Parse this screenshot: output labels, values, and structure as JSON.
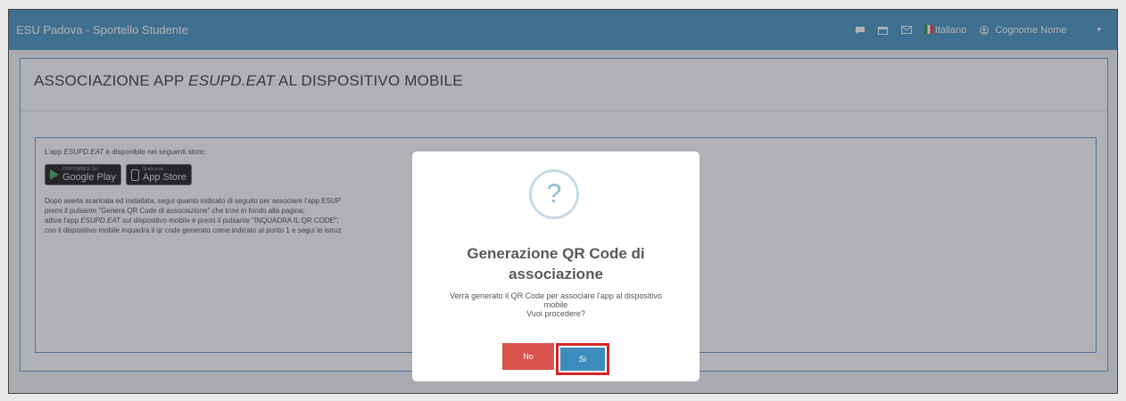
{
  "navbar": {
    "brand": "ESU Padova - Sportello Studente",
    "language": "Italiano",
    "user": "Cognome Nome"
  },
  "page": {
    "title_prefix": "ASSOCIAZIONE APP ",
    "title_app": "ESUPD.EAT",
    "title_suffix": " AL DISPOSITIVO MOBILE"
  },
  "body": {
    "intro_prefix": "L'app ",
    "intro_app": "ESUPD.EAT",
    "intro_suffix": " è disponibile nei seguenti store:",
    "google_play_small": "DISPONIBILE SU",
    "google_play": "Google Play",
    "app_store_small": "Scarica su",
    "app_store": "App Store",
    "step0": "Dopo averla scaricata ed installata, segui quanto indicato di seguito per associare l'app ESUP",
    "step1": "premi il pulsante \"Genera QR Code di associazione\" che trovi in fondo alla pagina;",
    "step2_prefix": "attiva l'app ",
    "step2_app": "ESUPD.EAT",
    "step2_suffix": " sul dispositivo mobile e premi il pulsante \"INQUADRA IL QR CODE\";",
    "step3": "con il dispositivo mobile inquadra il qr code generato come indicato al punto 1 e segui le istruz"
  },
  "modal": {
    "icon": "?",
    "title": "Generazione QR Code di associazione",
    "text_line1": "Verrà generato il QR Code per associare l'app al dispositivo mobile",
    "text_line2": "Vuoi procedere?",
    "no_label": "No",
    "yes_label": "Si"
  },
  "colors": {
    "navbar": "#3c8dbc",
    "confirm": "#3c8dbc",
    "cancel": "#d9534f",
    "highlight": "#d12727"
  }
}
